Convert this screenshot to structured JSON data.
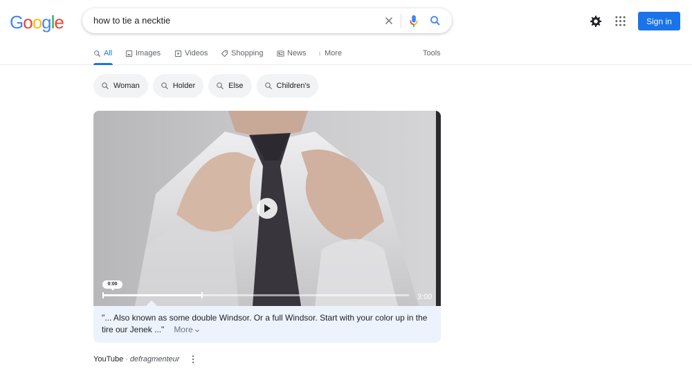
{
  "logo": {
    "text": "Google",
    "letters": [
      {
        "ch": "G",
        "color": "#4285f4"
      },
      {
        "ch": "o",
        "color": "#ea4335"
      },
      {
        "ch": "o",
        "color": "#fbbc05"
      },
      {
        "ch": "g",
        "color": "#4285f4"
      },
      {
        "ch": "l",
        "color": "#34a853"
      },
      {
        "ch": "e",
        "color": "#ea4335"
      }
    ]
  },
  "search": {
    "query": "how to tie a necktie",
    "icons": [
      "clear-icon",
      "microphone-icon",
      "search-icon"
    ]
  },
  "header": {
    "settings_icon": "gear-icon",
    "apps_icon": "apps-grid-icon",
    "sign_in_label": "Sign in"
  },
  "tabs": {
    "items": [
      {
        "label": "All",
        "icon": "search-icon",
        "active": true
      },
      {
        "label": "Images",
        "icon": "image-icon",
        "active": false
      },
      {
        "label": "Videos",
        "icon": "video-icon",
        "active": false
      },
      {
        "label": "Shopping",
        "icon": "tag-icon",
        "active": false
      },
      {
        "label": "News",
        "icon": "news-icon",
        "active": false
      },
      {
        "label": "More",
        "icon": "more-vert-icon",
        "active": false
      }
    ],
    "tools_label": "Tools"
  },
  "chips": [
    {
      "label": "Woman"
    },
    {
      "label": "Holder"
    },
    {
      "label": "Else"
    },
    {
      "label": "Children's"
    }
  ],
  "video": {
    "current_time": "0:00",
    "duration": "3:00",
    "highlight_progress_fraction": 0.325,
    "play_icon": "play-icon"
  },
  "caption": {
    "text": "\"... Also known as some double Windsor. Or a full Windsor. Start with your color up in the tire our Jenek ...\"",
    "more_label": "More"
  },
  "source": {
    "site": "YouTube",
    "separator": "·",
    "author": "defragmenteur"
  },
  "colors": {
    "accent": "#1a73e8",
    "chip_bg": "#f1f3f4",
    "caption_bg": "#edf3fc"
  }
}
